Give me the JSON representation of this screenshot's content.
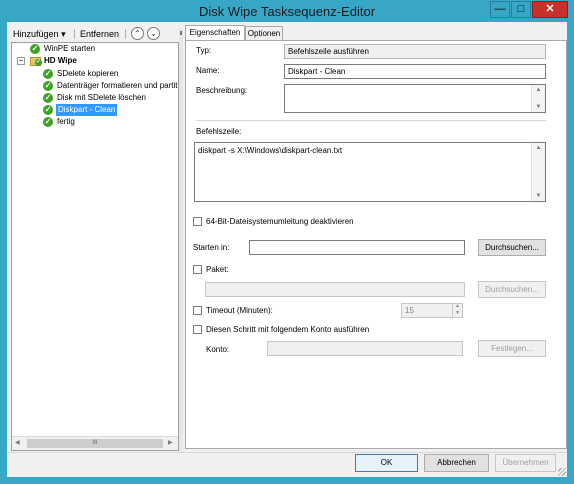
{
  "window": {
    "title": "Disk Wipe Tasksequenz-Editor",
    "minimize_glyph": "—",
    "maximize_glyph": "□",
    "close_glyph": "✕",
    "accent": "#38a7c7"
  },
  "toolbar": {
    "add_label": "Hinzufügen",
    "add_arrow": "▾",
    "remove_label": "Entfernen",
    "move_up_glyph": "⌃",
    "move_down_glyph": "⌄"
  },
  "tree": {
    "items": [
      {
        "label": "WinPE starten",
        "icon": "check-icon"
      },
      {
        "label": "HD Wipe",
        "icon": "folder-icon",
        "expander": "−"
      },
      {
        "label": "SDelete kopieren",
        "icon": "check-icon"
      },
      {
        "label": "Datenträger formatieren und partit",
        "icon": "check-icon"
      },
      {
        "label": "Disk mit SDelete löschen",
        "icon": "check-icon"
      },
      {
        "label": "Diskpart - Clean",
        "icon": "check-icon",
        "selected": true
      },
      {
        "label": "fertig",
        "icon": "check-icon"
      }
    ],
    "check_glyph": "✓",
    "scroll_left": "◀",
    "scroll_right": "▶",
    "scroll_thumb": "III"
  },
  "tabs": [
    {
      "label": "Eigenschaften",
      "active": true
    },
    {
      "label": "Optionen",
      "active": false
    }
  ],
  "properties": {
    "type_label": "Typ:",
    "type_value": "Befehlszeile ausführen",
    "name_label": "Name:",
    "name_value": "Diskpart - Clean",
    "description_label": "Beschreibung:",
    "description_value": "",
    "commandline_label": "Befehlszeile:",
    "commandline_value": "diskpart -s X:\\Windows\\diskpart-clean.txt",
    "redirect_label": "64-Bit-Dateisystemumleitung deaktivieren",
    "redirect_checked": false,
    "start_in_label": "Starten in:",
    "start_in_value": "",
    "browse_label": "Durchsuchen...",
    "package_label": "Paket:",
    "package_checked": false,
    "package_value": "",
    "browse_package_label": "Durchsuchen...",
    "timeout_label": "Timeout (Minuten):",
    "timeout_checked": false,
    "timeout_value": "15",
    "runas_label": "Diesen Schritt mit folgendem Konto ausführen",
    "runas_checked": false,
    "account_label": "Konto:",
    "account_value": "",
    "set_label": "Festlegen..."
  },
  "footer": {
    "ok_label": "OK",
    "cancel_label": "Abbrechen",
    "apply_label": "Übernehmen"
  }
}
